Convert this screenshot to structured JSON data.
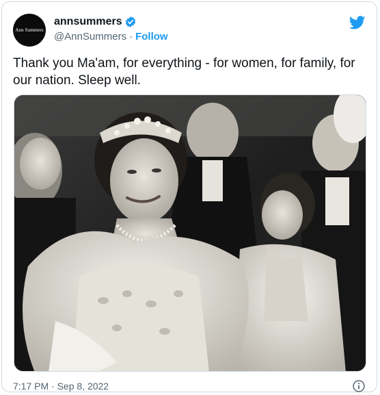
{
  "account": {
    "avatar_text": "Ann Summers",
    "display_name": "annsummers",
    "handle": "@AnnSummers",
    "separator": "·",
    "follow_label": "Follow"
  },
  "tweet": {
    "text": "Thank you Ma'am, for everything - for women, for family, for our nation. Sleep well.",
    "timestamp": "7:17 PM · Sep 8, 2022"
  },
  "icons": {
    "verified": "verified-badge-icon",
    "brand": "twitter-bird-icon",
    "info": "info-icon"
  },
  "colors": {
    "accent": "#1d9bf0",
    "text": "#0f1419",
    "secondary": "#536471",
    "border": "#cfd9de"
  }
}
